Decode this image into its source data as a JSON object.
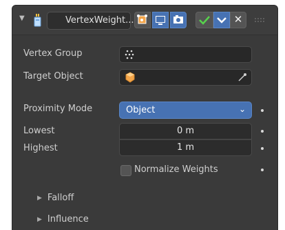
{
  "header": {
    "modifier_name": "VertexWeight...",
    "icons": [
      "collapse-arrow",
      "vertex-weight-modifier-icon",
      "edit-mode-icon",
      "viewport-display-icon",
      "render-icon",
      "apply-checkmark-icon",
      "dropdown-chevron-icon",
      "remove-x-icon",
      "drag-grip-icon"
    ],
    "remove_label": "✕"
  },
  "fields": {
    "vertex_group_label": "Vertex Group",
    "target_object_label": "Target Object",
    "proximity_mode_label": "Proximity Mode",
    "proximity_mode_value": "Object",
    "lowest_label": "Lowest",
    "lowest_value": "0 m",
    "highest_label": "Highest",
    "highest_value": "1 m",
    "normalize_label": "Normalize Weights",
    "normalize_checked": false
  },
  "subpanels": {
    "falloff": "Falloff",
    "influence": "Influence"
  },
  "colors": {
    "panel_bg": "#3a3a3a",
    "accent_blue": "#4772b3",
    "field_bg": "#282828"
  }
}
